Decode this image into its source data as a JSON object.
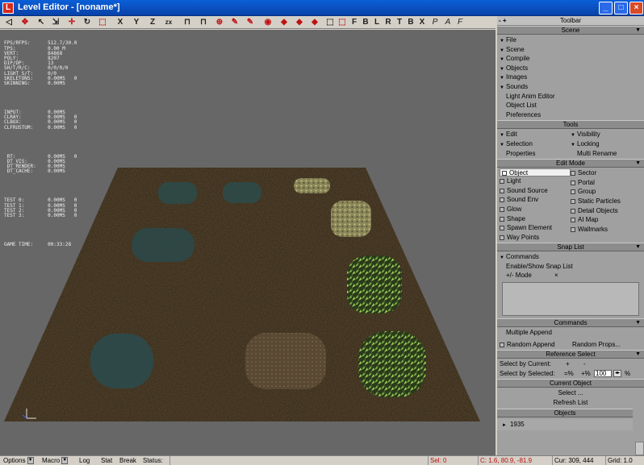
{
  "window": {
    "title": "Level Editor - [noname*]",
    "app_icon": "L",
    "controls": [
      "_",
      "□",
      "×"
    ]
  },
  "toolbar": {
    "buttons": [
      "◁",
      "✥",
      "↖",
      "⇲",
      "✛",
      "↻",
      "⬚",
      "X",
      "Y",
      "Z",
      "zx",
      "⊓",
      "⊓",
      "⊕",
      "✎",
      "✎",
      "◉",
      "◆",
      "◆",
      "◆",
      "⬚",
      "⬚",
      "F",
      "B",
      "L",
      "R",
      "T",
      "B",
      "X",
      "P",
      "A",
      "F"
    ]
  },
  "stats": {
    "block1": "FPS/RFPS:      512.7/30.0\nTPS:           0.00 M\nVERT:          84868\nPOLY:          8207\nDIP/DP:        13\nSH/T/R/C:      0/0/0/0\nLIGHT S/T:     0/0\nSKELETONS:     0.00MS   0\nSKINNING:      0.00MS",
    "block2": "INPUT:         0.00MS\nCLRAY:         0.00MS   0\nCLBOX:         0.00MS   0\nCLFRUSTUM:     0.00MS   0",
    "block3": " RT:           0.00MS   0\n DT_VIS:       0.00MS\n DT_RENDER:    0.00MS\n DT_CACHE:     0.00MS",
    "block4": "TEST 0:        0.00MS   0\nTEST 1:        0.00MS   0\nTEST 2:        0.00MS   0\nTEST 3:        0.00MS   0",
    "block5": "GAME TIME:     00:33:28"
  },
  "panel": {
    "header": "Toolbar",
    "header_pm": "- +",
    "scene": {
      "title": "Scene",
      "items": [
        "File",
        "Scene",
        "Compile",
        "Objects",
        "Images",
        "Sounds"
      ],
      "plain": [
        "Light Anim Editor",
        "Object List",
        "Preferences"
      ]
    },
    "tools": {
      "title": "Tools",
      "left": [
        "Edit",
        "Selection",
        "Properties"
      ],
      "right": [
        "Visibility",
        "Locking",
        "Multi Rename"
      ]
    },
    "edit_mode": {
      "title": "Edit Mode",
      "left": [
        "Object",
        "Light",
        "Sound Source",
        "Sound Env",
        "Glow",
        "Shape",
        "Spawn Element",
        "Way Points"
      ],
      "right": [
        "Sector",
        "Portal",
        "Group",
        "Static Particles",
        "Detail Objects",
        "AI Map",
        "Wallmarks"
      ]
    },
    "snap_list": {
      "title": "Snap List",
      "commands": "Commands",
      "enable": "Enable/Show Snap List",
      "mode_label": "+/- Mode",
      "mode_x": "×"
    },
    "commands": {
      "title": "Commands",
      "multiple_append": "Multiple Append",
      "random_append": "Random Append",
      "random_props": "Random Props..."
    },
    "reference_select": {
      "title": "Reference Select",
      "by_current": "Select by Current:",
      "by_current_plus": "+",
      "by_current_minus": "-",
      "by_selected": "Select by Selected:",
      "minus_pct": "=%",
      "plus_pct": "+%",
      "value": "100",
      "pct": "%"
    },
    "current_object": {
      "title": "Current Object",
      "select": "Select ...",
      "refresh": "Refresh List"
    },
    "objects": {
      "title": "Objects",
      "count": "1935"
    }
  },
  "statusbar": {
    "options": "Options",
    "macro": "Macro",
    "log": "Log",
    "stat": "Stat",
    "break": "Break",
    "status": "Status:",
    "sel": "Sel: 0",
    "coords": "C: 1.6, 80.9, -81.9",
    "cur": "Cur: 309, 444",
    "grid": "Grid: 1.0"
  }
}
